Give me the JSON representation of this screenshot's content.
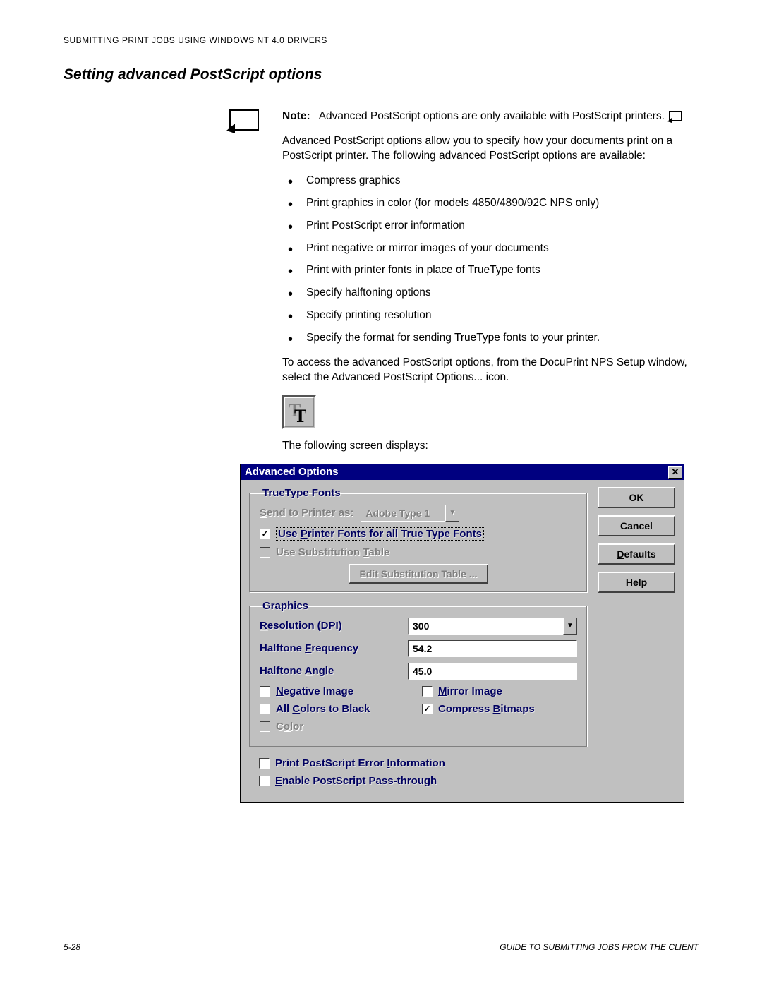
{
  "header": {
    "running": "SUBMITTING PRINT JOBS USING WINDOWS NT 4.0 DRIVERS"
  },
  "section": {
    "title": "Setting advanced PostScript options"
  },
  "note": {
    "label": "Note:",
    "text": "Advanced PostScript options are only available with PostScript printers."
  },
  "intro": "Advanced PostScript options allow you to specify how your documents print on a PostScript printer.  The following advanced PostScript options are available:",
  "bullets": [
    "Compress graphics",
    "Print graphics in color (for models 4850/4890/92C NPS only)",
    "Print PostScript error information",
    "Print negative or mirror images of your documents",
    "Print with printer fonts in place of TrueType fonts",
    "Specify halftoning options",
    "Specify printing resolution",
    "Specify the format for sending TrueType fonts to your printer."
  ],
  "access": "To access the advanced PostScript options, from the DocuPrint NPS Setup window, select the Advanced PostScript Options... icon.",
  "following": "The following screen displays:",
  "dialog": {
    "title": "Advanced Options",
    "buttons": {
      "ok": "OK",
      "cancel": "Cancel",
      "defaults": "Defaults",
      "help": "Help"
    },
    "truetype": {
      "legend": "TrueType Fonts",
      "send_label": "Send to Printer as:",
      "send_value": "Adobe Type 1",
      "use_printer_fonts": "Use Printer Fonts for all True Type Fonts",
      "use_subst": "Use Substitution Table",
      "edit_btn": "Edit Substitution Table ..."
    },
    "graphics": {
      "legend": "Graphics",
      "resolution_label": "Resolution (DPI)",
      "resolution_value": "300",
      "halftone_freq_label": "Halftone Frequency",
      "halftone_freq_value": "54.2",
      "halftone_angle_label": "Halftone Angle",
      "halftone_angle_value": "45.0",
      "negative": "Negative Image",
      "mirror": "Mirror Image",
      "all_black": "All Colors to Black",
      "compress": "Compress Bitmaps",
      "color": "Color"
    },
    "extra": {
      "ps_error": "Print PostScript Error Information",
      "passthrough": "Enable PostScript Pass-through"
    }
  },
  "footer": {
    "page": "5-28",
    "book": "GUIDE TO SUBMITTING JOBS FROM THE CLIENT"
  }
}
